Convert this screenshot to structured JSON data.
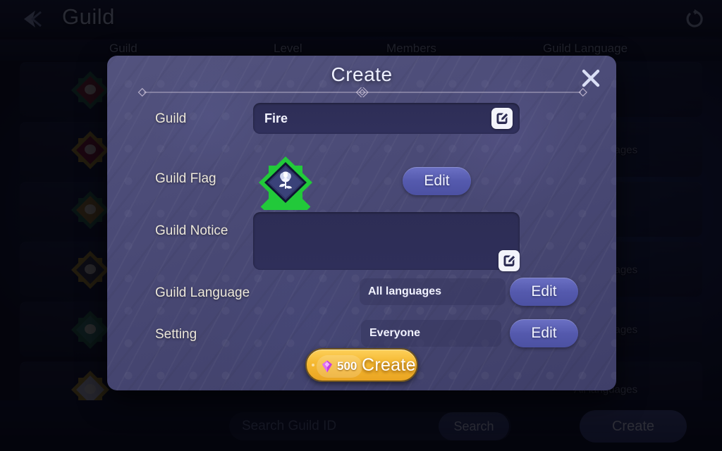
{
  "header": {
    "title": "Guild",
    "back_icon": "back-arrow-icon",
    "refresh_icon": "refresh-icon"
  },
  "list_headers": {
    "guild": "Guild",
    "level": "Level",
    "members": "Members",
    "language": "Guild Language"
  },
  "background_rows": [
    {
      "name": "",
      "level": "",
      "members": "",
      "language": "",
      "frame": "#1f6b44",
      "inner": "#8f2230"
    },
    {
      "name": "",
      "level": "",
      "members": "",
      "language": "All languages",
      "frame": "#b08a18",
      "inner": "#8c1436"
    },
    {
      "name": "",
      "level": "",
      "members": "",
      "language": "",
      "frame": "#1f6b44",
      "inner": "#9a7320"
    },
    {
      "name": "",
      "level": "",
      "members": "",
      "language": "All languages",
      "frame": "#b08a18",
      "inner": "#3a3a46"
    },
    {
      "name": "",
      "level": "",
      "members": "",
      "language": "All languages",
      "frame": "#1f6b44",
      "inner": "#2e7a62"
    },
    {
      "name": "",
      "level": "",
      "members": "",
      "language": "All languages",
      "frame": "#b08a18",
      "inner": "#b9bccb"
    }
  ],
  "bottom_bar": {
    "search_placeholder": "Search Guild ID",
    "search_value": "",
    "search_button": "Search",
    "create_button": "Create"
  },
  "modal": {
    "title": "Create",
    "close_icon": "close-icon",
    "rows": {
      "guild": {
        "label": "Guild",
        "value": "Fire",
        "edit_icon": "edit-pencil-icon"
      },
      "guild_flag": {
        "label": "Guild Flag",
        "emblem_icon": "rose-emblem-icon",
        "frame_color": "#22c93a",
        "inner_color": "#2b3260",
        "edit_button": "Edit"
      },
      "guild_notice": {
        "label": "Guild Notice",
        "value": "",
        "edit_icon": "edit-pencil-icon"
      },
      "guild_language": {
        "label": "Guild Language",
        "value": "All languages",
        "edit_button": "Edit"
      },
      "setting": {
        "label": "Setting",
        "value": "Everyone",
        "edit_button": "Edit"
      }
    },
    "create_button": {
      "cost": "500",
      "currency_icon": "gem-icon",
      "label": "Create"
    }
  },
  "colors": {
    "modal_bg": "#4a4a75",
    "accent_gold": "#f5b932",
    "edit_pill": "#5a5fb4",
    "flag_green": "#22c93a",
    "gem_purple": "#c63fe0"
  }
}
